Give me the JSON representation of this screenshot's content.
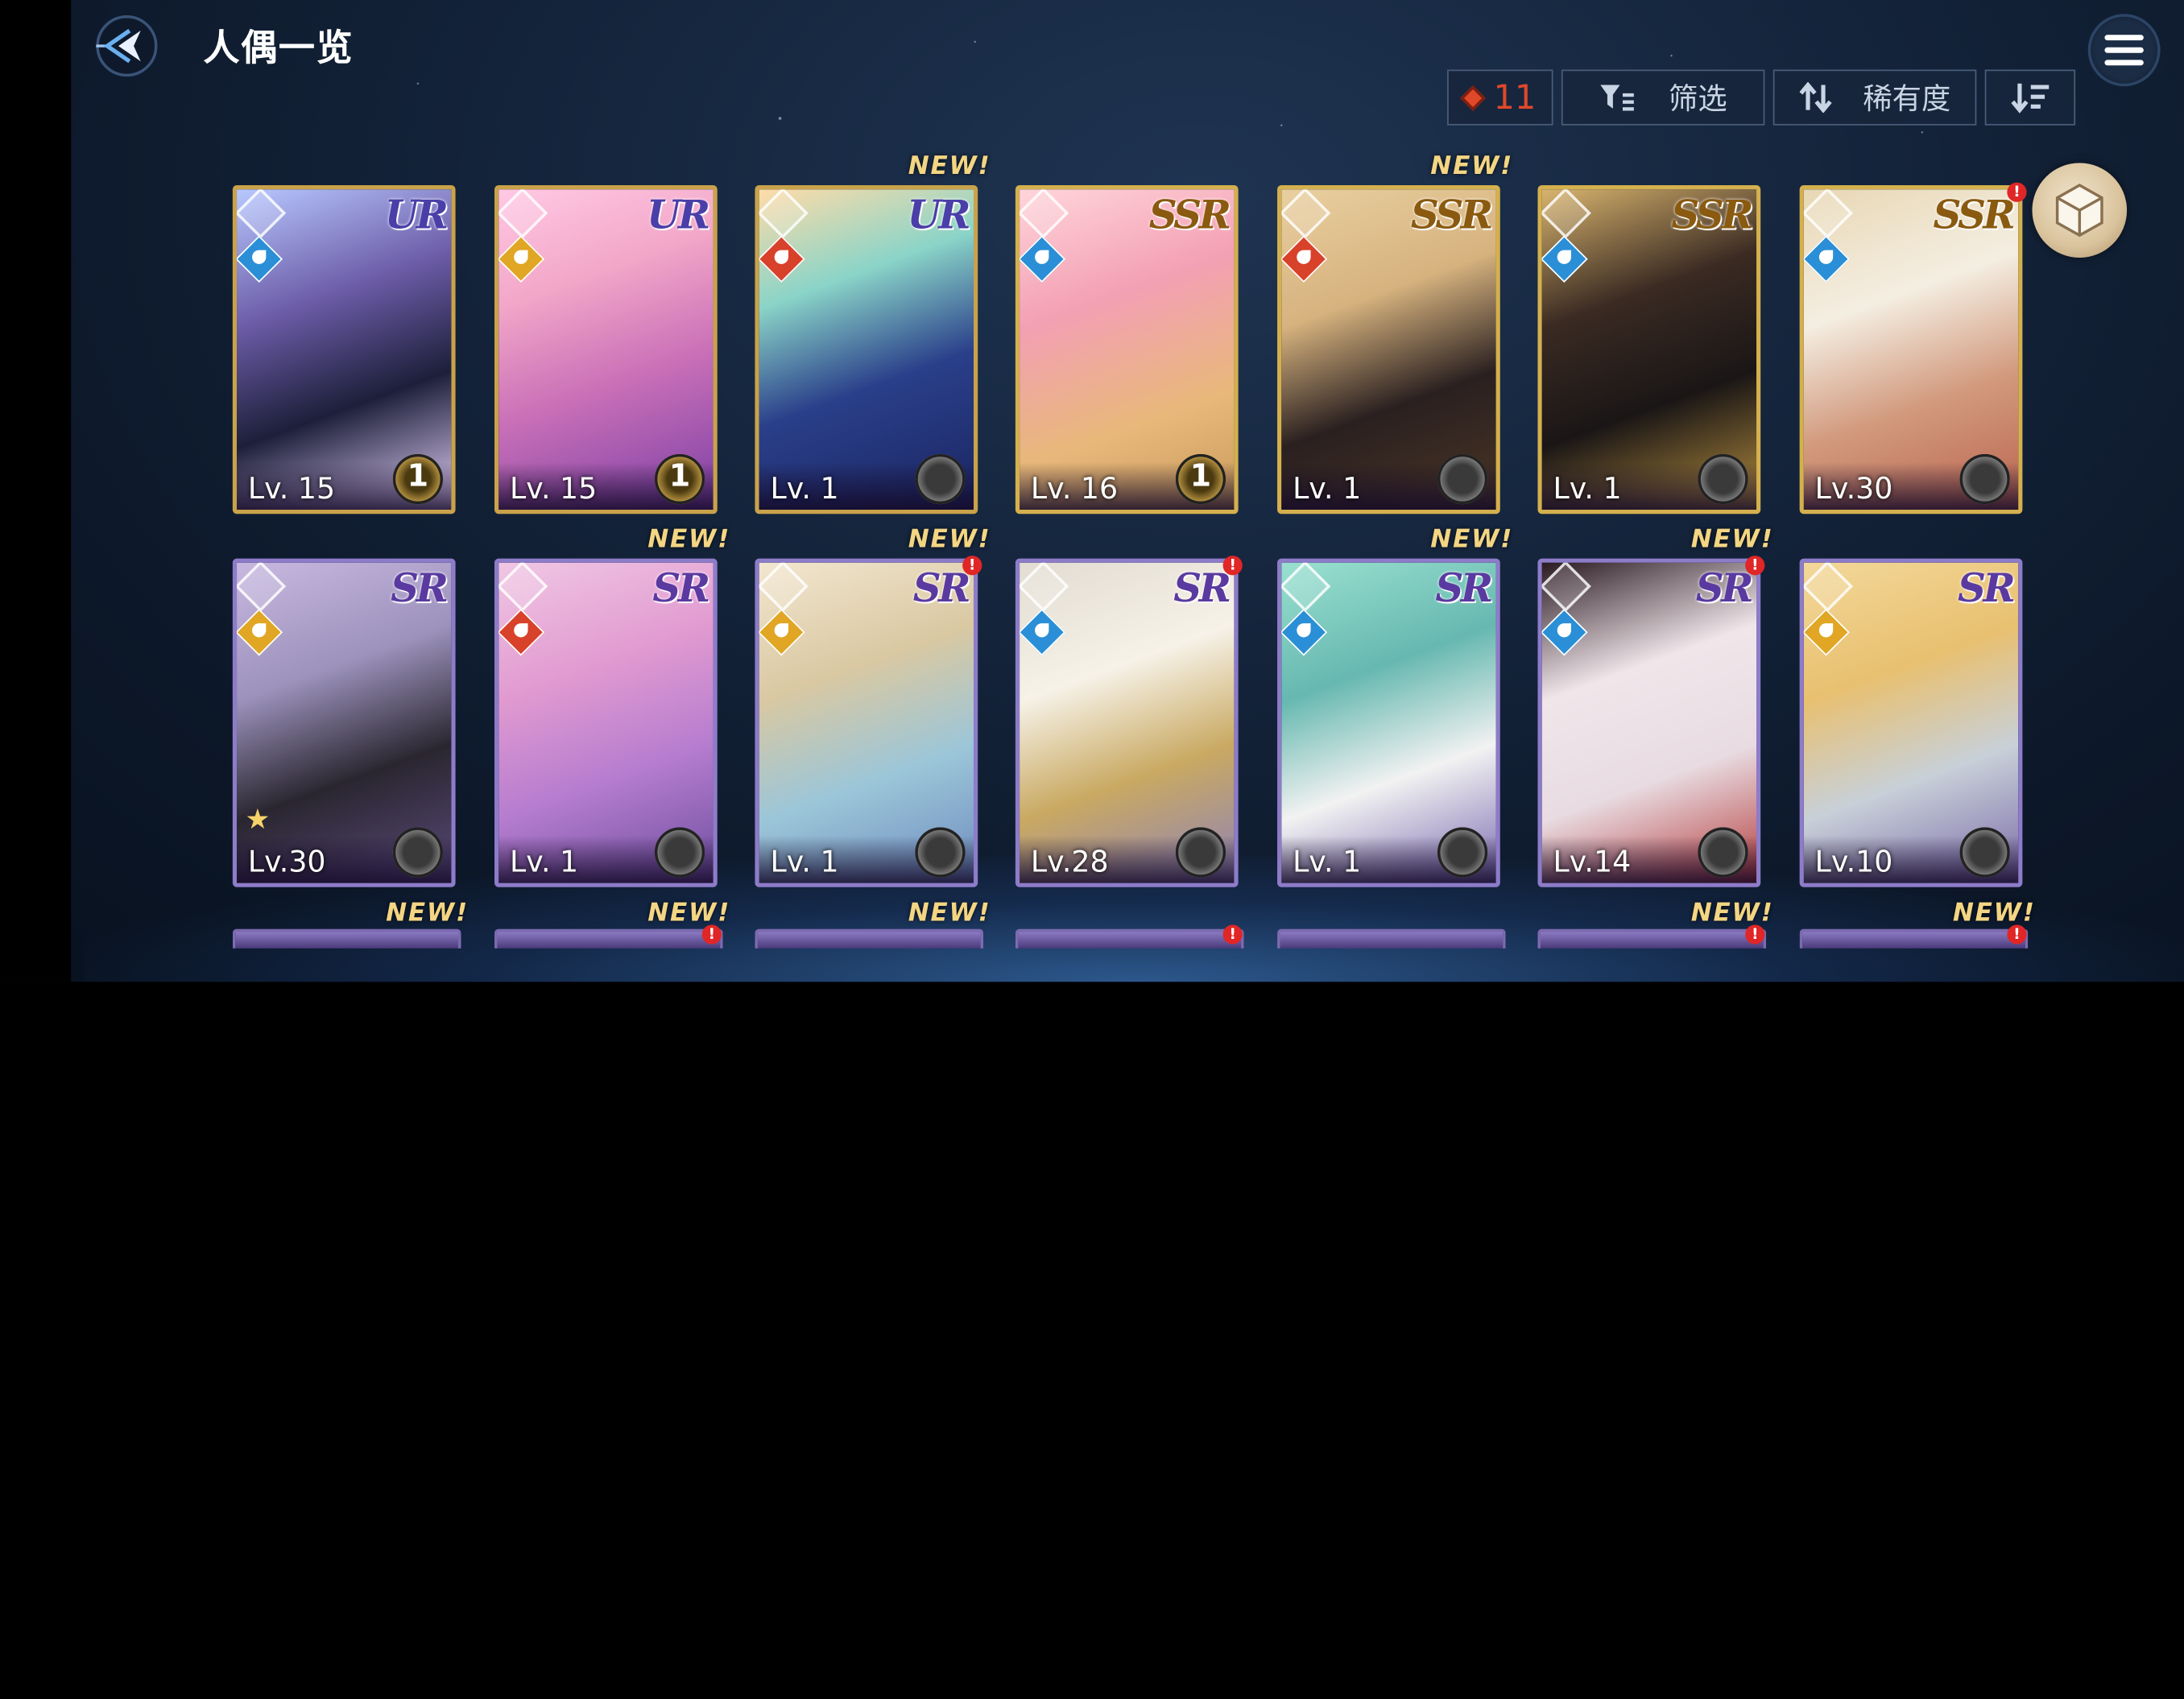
{
  "header": {
    "title": "人偶一览",
    "back_icon": "back-arrow-icon",
    "menu_icon": "hamburger-menu-icon"
  },
  "toolbar": {
    "count": "11",
    "count_icon": "red-gem-icon",
    "filter_label": "筛选",
    "filter_icon": "filter-icon",
    "sort_label": "稀有度",
    "sort_icon": "swap-vertical-icon",
    "order_icon": "sort-descending-icon",
    "side_icon": "cube-icon"
  },
  "colors": {
    "ur_frame": "#c9a24a",
    "ssr_frame": "#d4b04e",
    "sr_frame": "#8d7cc9",
    "new_tag": "#f3d583",
    "alert": "#e02626",
    "count_red": "#e0482a",
    "water": "#2a8fd6",
    "fire": "#d8412a",
    "light": "#e0a624"
  },
  "cards": [
    {
      "rarity": "UR",
      "level": "Lv. 15",
      "element": "water",
      "medal": "1",
      "new": false,
      "alert": false
    },
    {
      "rarity": "UR",
      "level": "Lv. 15",
      "element": "light",
      "medal": "1",
      "new": false,
      "alert": false
    },
    {
      "rarity": "UR",
      "level": "Lv. 1",
      "element": "fire",
      "medal": "",
      "new": true,
      "alert": false
    },
    {
      "rarity": "SSR",
      "level": "Lv. 16",
      "element": "water",
      "medal": "1",
      "new": false,
      "alert": false
    },
    {
      "rarity": "SSR",
      "level": "Lv. 1",
      "element": "fire",
      "medal": "",
      "new": true,
      "alert": false
    },
    {
      "rarity": "SSR",
      "level": "Lv. 1",
      "element": "water",
      "medal": "",
      "new": false,
      "alert": false
    },
    {
      "rarity": "SSR",
      "level": "Lv.30",
      "element": "water",
      "medal": "",
      "new": false,
      "alert": true
    },
    {
      "rarity": "SR",
      "level": "Lv.30",
      "element": "light",
      "medal": "",
      "new": false,
      "alert": false,
      "star": true
    },
    {
      "rarity": "SR",
      "level": "Lv. 1",
      "element": "fire",
      "medal": "",
      "new": true,
      "alert": false
    },
    {
      "rarity": "SR",
      "level": "Lv. 1",
      "element": "light",
      "medal": "",
      "new": true,
      "alert": true
    },
    {
      "rarity": "SR",
      "level": "Lv.28",
      "element": "water",
      "medal": "",
      "new": false,
      "alert": true
    },
    {
      "rarity": "SR",
      "level": "Lv. 1",
      "element": "water",
      "medal": "",
      "new": true,
      "alert": false
    },
    {
      "rarity": "SR",
      "level": "Lv.14",
      "element": "water",
      "medal": "",
      "new": true,
      "alert": true
    },
    {
      "rarity": "SR",
      "level": "Lv.10",
      "element": "light",
      "medal": "",
      "new": false,
      "alert": false
    }
  ],
  "new_label": "NEW!",
  "alert_label": "!",
  "third_row_new": [
    true,
    true,
    true,
    false,
    false,
    true,
    true
  ],
  "third_row_alert": [
    false,
    true,
    false,
    true,
    false,
    true,
    true
  ]
}
